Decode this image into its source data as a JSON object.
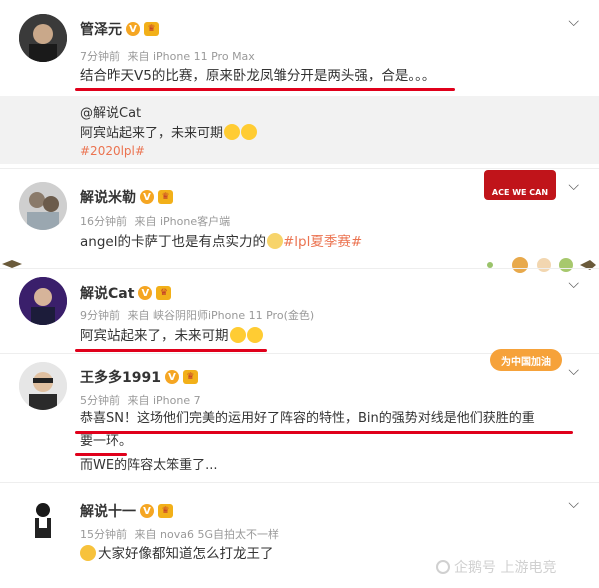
{
  "posts": [
    {
      "name": "管泽元",
      "time": "7分钟前",
      "source": "来自 iPhone 11 Pro Max",
      "text": "结合昨天V5的比赛，原来卧龙凤雏分开是两头强，合是。。。",
      "repost": {
        "author": "@解说Cat",
        "text": "阿宾站起来了，未来可期",
        "tag": "#2020lpl#"
      }
    },
    {
      "name": "解说米勒",
      "time": "16分钟前",
      "source": "来自 iPhone客户端",
      "text_pre": "angel的卡萨丁也是有点实力的",
      "tag": "#lpl夏季赛#",
      "sticker": "ACE WE CAN"
    },
    {
      "name": "解说Cat",
      "time": "9分钟前",
      "source": "来自 峡谷阴阳师iPhone 11 Pro(金色)",
      "text": "阿宾站起来了，未来可期"
    },
    {
      "name": "王多多1991",
      "time": "5分钟前",
      "source": "来自 iPhone 7",
      "text_line1": "恭喜SN！这场他们完美的运用好了阵容的特性，Bin的强势对线是他们获胜的重",
      "text_line2": "要一环。",
      "text_line3": "而WE的阵容太笨重了...",
      "sticker": "为中国加油"
    },
    {
      "name": "解说十一",
      "time": "15分钟前",
      "source": "来自 nova6 5G自拍太不一样",
      "text": "大家好像都知道怎么打龙王了"
    }
  ],
  "watermark": "企鹅号 上游电竞",
  "colors": {
    "accent_red": "#e0001b",
    "tag": "#eb7350",
    "meta": "#999999"
  }
}
